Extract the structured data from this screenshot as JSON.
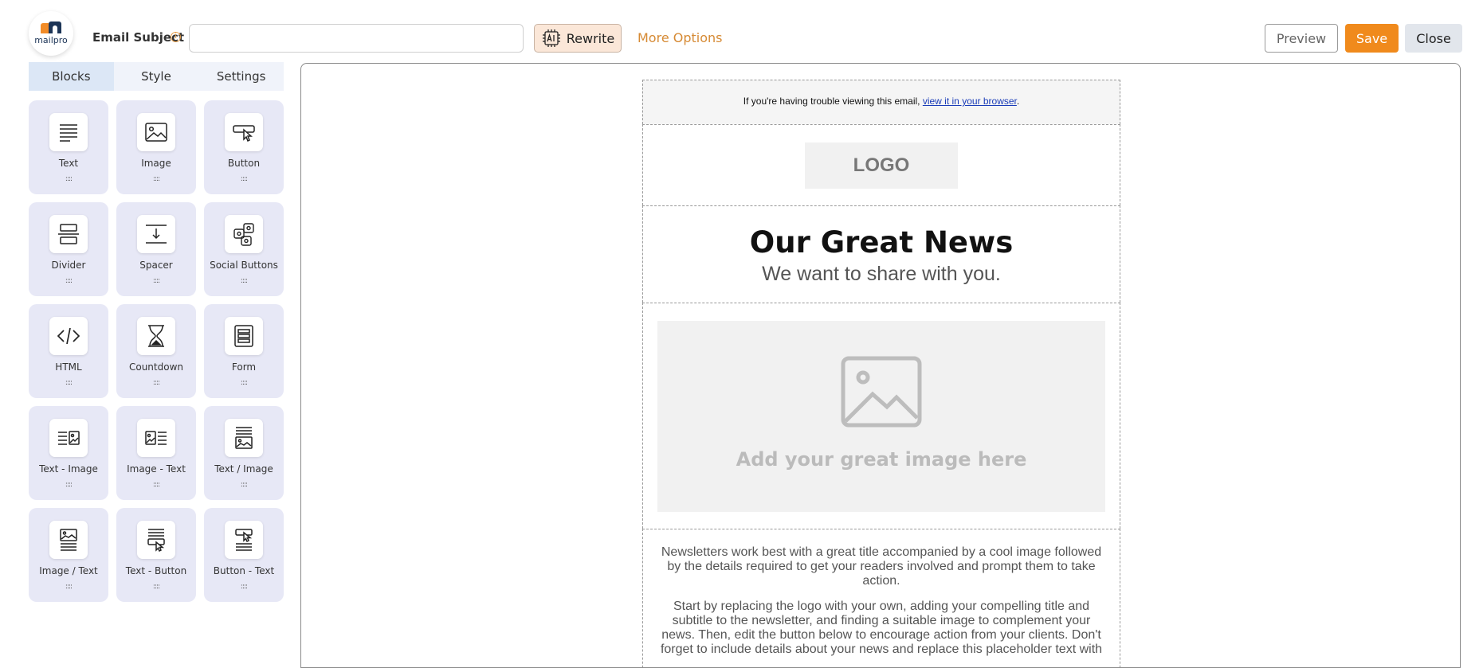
{
  "app": {
    "logo_word": "mailpro"
  },
  "header": {
    "subject_label": "Email Subject",
    "info_glyph": "i",
    "subject_value": "",
    "rewrite_label": "Rewrite",
    "more_options_label": "More Options",
    "preview_label": "Preview",
    "save_label": "Save",
    "close_label": "Close",
    "accent": "#f08a1c"
  },
  "sidebar": {
    "tabs": [
      {
        "label": "Blocks",
        "active": true
      },
      {
        "label": "Style",
        "active": false
      },
      {
        "label": "Settings",
        "active": false
      }
    ],
    "blocks": [
      {
        "label": "Text",
        "icon": "text-icon"
      },
      {
        "label": "Image",
        "icon": "image-icon"
      },
      {
        "label": "Button",
        "icon": "button-icon"
      },
      {
        "label": "Divider",
        "icon": "divider-icon"
      },
      {
        "label": "Spacer",
        "icon": "spacer-icon"
      },
      {
        "label": "Social Buttons",
        "icon": "social-buttons-icon"
      },
      {
        "label": "HTML",
        "icon": "html-code-icon"
      },
      {
        "label": "Countdown",
        "icon": "hourglass-icon"
      },
      {
        "label": "Form",
        "icon": "form-icon"
      },
      {
        "label": "Text - Image",
        "icon": "text-image-icon"
      },
      {
        "label": "Image - Text",
        "icon": "image-text-icon"
      },
      {
        "label": "Text / Image",
        "icon": "text-over-image-icon"
      },
      {
        "label": "Image / Text",
        "icon": "image-over-text-icon"
      },
      {
        "label": "Text - Button",
        "icon": "text-button-icon"
      },
      {
        "label": "Button - Text",
        "icon": "button-text-icon"
      }
    ],
    "grip_glyph": "::::"
  },
  "email": {
    "preheader_text": "If you're having trouble viewing this email, ",
    "preheader_link": "view it in your browser",
    "preheader_end": ".",
    "logo_placeholder": "LOGO",
    "title": "Our Great News",
    "subtitle": "We want to share with you.",
    "image_caption": "Add your great image here",
    "paragraphs": [
      "Newsletters work best with a great title accompanied by a cool image followed by the details required to get your readers involved and prompt them to take action.",
      "Start by replacing the logo with your own, adding your compelling title and subtitle to the newsletter, and finding a suitable image to complement your news. Then, edit the button below to encourage action from your clients. Don't forget to include details about your news and replace this placeholder text with"
    ]
  }
}
